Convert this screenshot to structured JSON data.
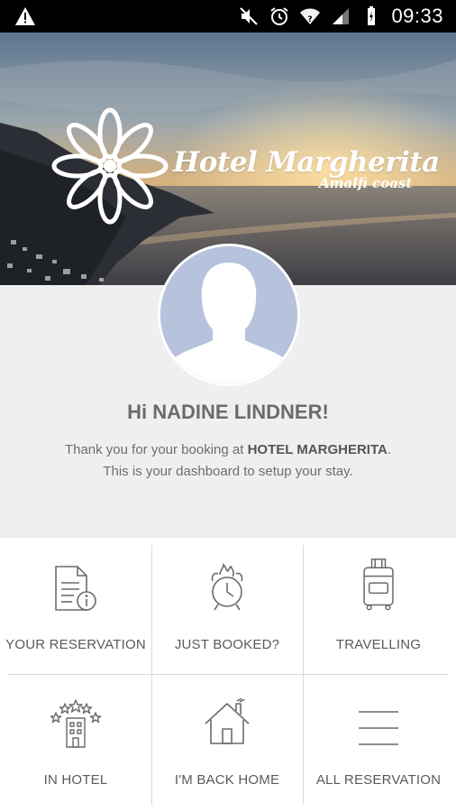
{
  "status_bar": {
    "time": "09:33",
    "icons": [
      "warning-icon",
      "mute-icon",
      "alarm-icon",
      "wifi-icon",
      "signal-icon",
      "battery-charging-icon"
    ]
  },
  "hero": {
    "brand_name": "Hotel Margherita",
    "brand_subtitle": "Amalfi coast",
    "logo_icon": "daisy-flower-icon"
  },
  "profile": {
    "avatar_icon": "default-avatar-silhouette",
    "greeting": "Hi NADINE LINDNER!",
    "message_prefix": "Thank you for your booking at ",
    "hotel_name": "HOTEL MARGHERITA",
    "message_suffix": ".",
    "message_line2": "This is your dashboard to setup your stay."
  },
  "tiles": [
    {
      "label": "YOUR RESERVATION",
      "icon": "document-info-icon"
    },
    {
      "label": "JUST BOOKED?",
      "icon": "alarm-clock-fire-icon"
    },
    {
      "label": "TRAVELLING",
      "icon": "suitcase-icon"
    },
    {
      "label": "IN HOTEL",
      "icon": "hotel-stars-icon"
    },
    {
      "label": "I'M BACK HOME",
      "icon": "house-icon"
    },
    {
      "label": "ALL RESERVATION",
      "icon": "menu-lines-icon"
    }
  ],
  "colors": {
    "background": "#efefef",
    "text": "#6b6b6b",
    "icon_stroke": "#6a6a6a",
    "avatar_bg": "#b7c2dc",
    "divider": "#d9d9d9"
  }
}
